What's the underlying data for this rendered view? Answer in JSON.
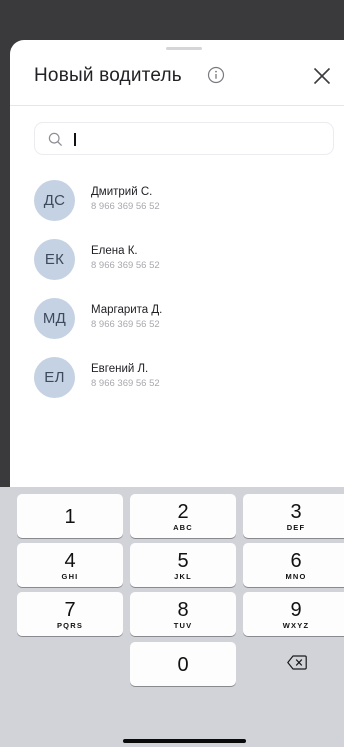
{
  "sheet": {
    "title": "Новый водитель",
    "info_icon": "info-circle-icon",
    "close_icon": "close-icon"
  },
  "search": {
    "value": "",
    "placeholder": "",
    "icon": "search-icon"
  },
  "contacts": [
    {
      "initials": "ДС",
      "name": "Дмитрий С.",
      "phone": "8 966 369 56 52"
    },
    {
      "initials": "ЕК",
      "name": "Елена К.",
      "phone": "8 966 369 56 52"
    },
    {
      "initials": "МД",
      "name": "Маргарита Д.",
      "phone": "8 966 369 56 52"
    },
    {
      "initials": "ЕЛ",
      "name": "Евгений Л.",
      "phone": "8 966 369 56 52"
    }
  ],
  "keyboard": {
    "keys": [
      {
        "digit": "1",
        "letters": ""
      },
      {
        "digit": "2",
        "letters": "ABC"
      },
      {
        "digit": "3",
        "letters": "DEF"
      },
      {
        "digit": "4",
        "letters": "GHI"
      },
      {
        "digit": "5",
        "letters": "JKL"
      },
      {
        "digit": "6",
        "letters": "MNO"
      },
      {
        "digit": "7",
        "letters": "PQRS"
      },
      {
        "digit": "8",
        "letters": "TUV"
      },
      {
        "digit": "9",
        "letters": "WXYZ"
      },
      {
        "digit": "0",
        "letters": ""
      }
    ],
    "backspace_icon": "backspace-icon"
  },
  "colors": {
    "avatar_bg": "#c4d2e3",
    "keyboard_bg": "#d1d3d9",
    "backdrop": "#3a3a3c"
  }
}
